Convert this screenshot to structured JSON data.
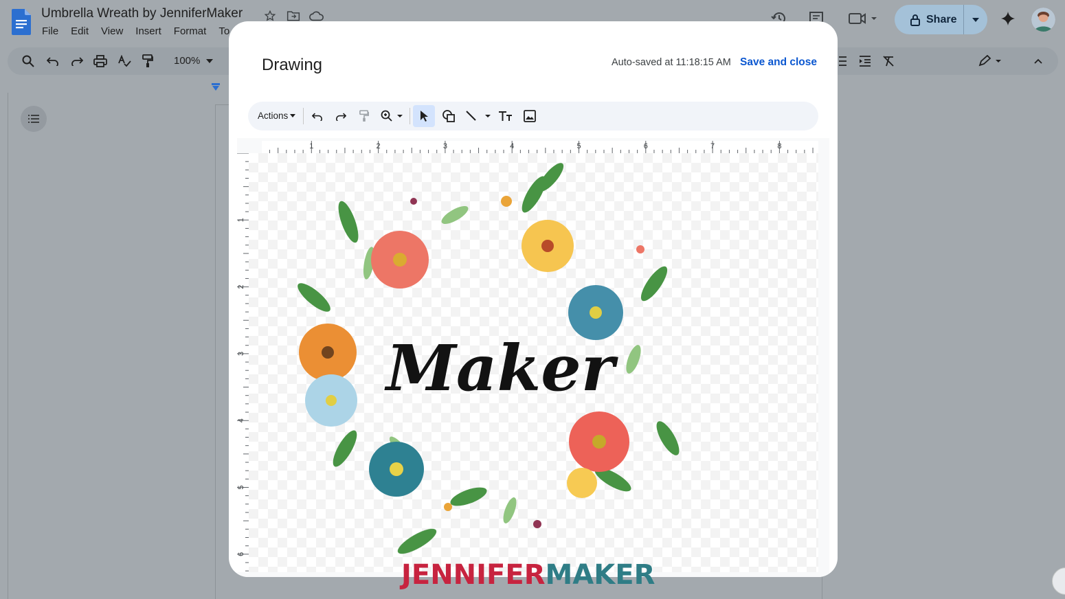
{
  "document": {
    "title": "Umbrella Wreath by JenniferMaker",
    "menu": [
      "File",
      "Edit",
      "View",
      "Insert",
      "Format",
      "To"
    ]
  },
  "header": {
    "share_label": "Share"
  },
  "toolbar": {
    "zoom": "100%"
  },
  "dialog": {
    "title": "Drawing",
    "autosave": "Auto-saved at 11:18:15 AM",
    "save_close": "Save and close",
    "actions_label": "Actions",
    "h_ruler_labels": [
      "1",
      "2",
      "3",
      "4",
      "5",
      "6",
      "7",
      "8"
    ],
    "v_ruler_labels": [
      "1",
      "2",
      "3",
      "4",
      "5",
      "6"
    ],
    "canvas_text": "Maker"
  },
  "watermark": {
    "part1": "JENNIFER",
    "part2": "MAKER"
  },
  "colors": {
    "accent": "#0b57d0",
    "share_bg": "#a4c1d8",
    "watermark_red": "#c7233f",
    "watermark_teal": "#2f7d86"
  }
}
